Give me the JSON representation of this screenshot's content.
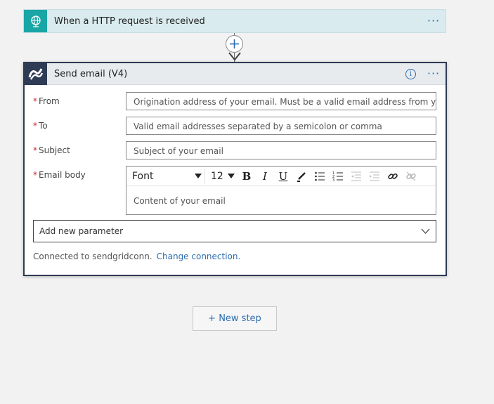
{
  "trigger": {
    "title": "When a HTTP request is received",
    "more": "···"
  },
  "action": {
    "title": "Send email (V4)",
    "more": "···",
    "info": "i",
    "fields": {
      "from": {
        "label": "From",
        "placeholder": "Origination address of your email. Must be a valid email address from your"
      },
      "to": {
        "label": "To",
        "placeholder": "Valid email addresses separated by a semicolon or comma"
      },
      "subject": {
        "label": "Subject",
        "placeholder": "Subject of your email"
      },
      "body": {
        "label": "Email body",
        "placeholder": "Content of your email"
      }
    },
    "toolbar": {
      "font": "Font",
      "size": "12",
      "bold": "B",
      "italic": "I",
      "underline": "U"
    },
    "add_param": "Add new parameter",
    "connected_text": "Connected to sendgridconn.",
    "change_connection": "Change connection."
  },
  "new_step": "+ New step",
  "colors": {
    "accent": "#2b6cb0",
    "trigger_icon_bg": "#1aa6a6",
    "card_border": "#2e3b55",
    "required": "#c62828"
  }
}
